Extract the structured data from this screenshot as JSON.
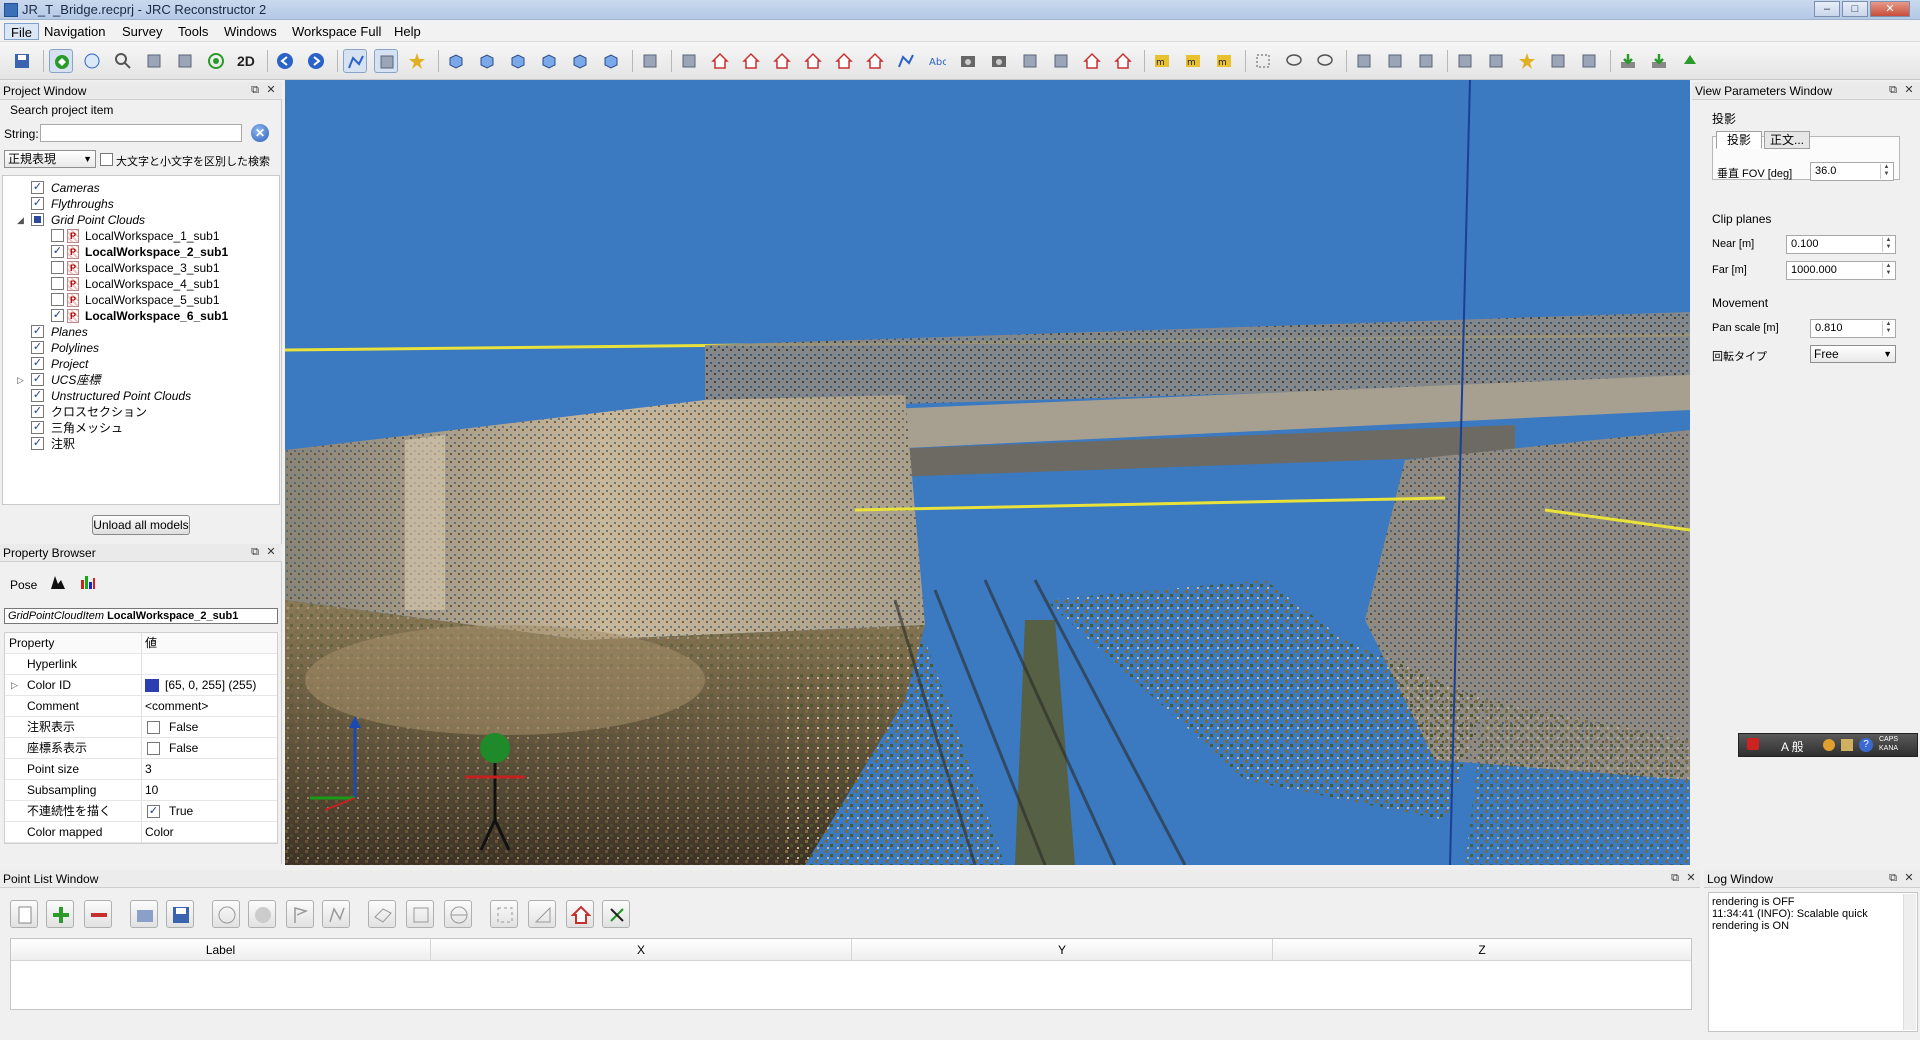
{
  "window": {
    "title": "JR_T_Bridge.recprj - JRC Reconstructor 2",
    "min_label": "–",
    "max_label": "□",
    "close_label": "✕"
  },
  "menu": [
    "File",
    "Navigation",
    "Survey",
    "Tools",
    "Windows",
    "Workspace Full",
    "Help"
  ],
  "toolbar": {
    "mode_2d_label": "2D",
    "icons": [
      "save-icon",
      "select-icon",
      "sphere-icon",
      "zoom-icon",
      "pick-point-icon",
      "move-icon",
      "target-icon",
      "back-arrow-icon",
      "forward-arrow-icon",
      "measure-icon",
      "pan-icon",
      "star-icon",
      "cube-front-icon",
      "cube-back-icon",
      "cube-left-icon",
      "cube-right-icon",
      "cube-top-icon",
      "cube-bottom-icon",
      "pipette-icon",
      "palette-icon",
      "house-icon",
      "house-alt-icon",
      "building-icon",
      "camera-house-icon",
      "grid-house-icon",
      "home-icon",
      "polyline-icon",
      "text-icon",
      "camera-icon",
      "photo-icon",
      "eye-icon",
      "stripes-icon",
      "house-arrow-icon",
      "house-blue-icon",
      "area-icon",
      "volume-icon",
      "m3-icon",
      "rect-select-icon",
      "lasso-icon",
      "lasso-alt-icon",
      "mesh-icon",
      "scissors-icon",
      "filter-icon",
      "layers-icon",
      "layers-alt-icon",
      "sparkle-icon",
      "hand-icon",
      "grid-icon",
      "export-icon",
      "download-icon",
      "recycle-icon"
    ]
  },
  "project_window": {
    "title": "Project Window",
    "search_label": "Search project item",
    "string_label": "String:",
    "string_value": "",
    "mode_value": "正規表現",
    "case_label": "大文字と小文字を区別した検索",
    "tree": [
      {
        "label": "Cameras",
        "checked": true,
        "level": 0,
        "kind": "cat"
      },
      {
        "label": "Flythroughs",
        "checked": true,
        "level": 0,
        "kind": "cat"
      },
      {
        "label": "Grid Point Clouds",
        "checked": "partial",
        "level": 0,
        "kind": "cat",
        "expander": "◢"
      },
      {
        "label": "LocalWorkspace_1_sub1",
        "checked": false,
        "level": 1,
        "kind": "item"
      },
      {
        "label": "LocalWorkspace_2_sub1",
        "checked": true,
        "level": 1,
        "kind": "bold"
      },
      {
        "label": "LocalWorkspace_3_sub1",
        "checked": false,
        "level": 1,
        "kind": "item"
      },
      {
        "label": "LocalWorkspace_4_sub1",
        "checked": false,
        "level": 1,
        "kind": "item"
      },
      {
        "label": "LocalWorkspace_5_sub1",
        "checked": false,
        "level": 1,
        "kind": "item"
      },
      {
        "label": "LocalWorkspace_6_sub1",
        "checked": true,
        "level": 1,
        "kind": "bold"
      },
      {
        "label": "Planes",
        "checked": true,
        "level": 0,
        "kind": "cat"
      },
      {
        "label": "Polylines",
        "checked": true,
        "level": 0,
        "kind": "cat"
      },
      {
        "label": "Project",
        "checked": true,
        "level": 0,
        "kind": "cat"
      },
      {
        "label": "UCS座標",
        "checked": true,
        "level": 0,
        "kind": "cat",
        "expander": "▷"
      },
      {
        "label": "Unstructured Point Clouds",
        "checked": true,
        "level": 0,
        "kind": "cat"
      },
      {
        "label": "クロスセクション",
        "checked": true,
        "level": 0,
        "kind": "plain"
      },
      {
        "label": "三角メッシュ",
        "checked": true,
        "level": 0,
        "kind": "plain"
      },
      {
        "label": "注釈",
        "checked": true,
        "level": 0,
        "kind": "plain"
      }
    ],
    "unload_label": "Unload all models"
  },
  "property_browser": {
    "title": "Property Browser",
    "pose_label": "Pose",
    "item_type": "GridPointCloudItem",
    "item_name": "LocalWorkspace_2_sub1",
    "header_property": "Property",
    "header_value": "値",
    "rows": [
      {
        "name": "Hyperlink",
        "value": ""
      },
      {
        "name": "Color ID",
        "value": "[65, 0, 255] (255)",
        "swatch": "#2b3fb0",
        "expander": "▷"
      },
      {
        "name": "Comment",
        "value": "<comment>"
      },
      {
        "name": "注釈表示",
        "value": "False",
        "check": false
      },
      {
        "name": "座標系表示",
        "value": "False",
        "check": false
      },
      {
        "name": "Point size",
        "value": "3"
      },
      {
        "name": "Subsampling",
        "value": "10"
      },
      {
        "name": "不連続性を描く",
        "value": "True",
        "check": true
      },
      {
        "name": "Color mapped",
        "value": "Color"
      }
    ]
  },
  "view_params": {
    "title": "View Parameters Window",
    "projection_group": "投影",
    "tabs": [
      "投影",
      "正文..."
    ],
    "fov_label": "垂直 FOV [deg]",
    "fov_value": "36.0",
    "clip_group": "Clip planes",
    "near_label": "Near [m]",
    "near_value": "0.100",
    "far_label": "Far [m]",
    "far_value": "1000.000",
    "movement_group": "Movement",
    "pan_label": "Pan scale [m]",
    "pan_value": "0.810",
    "rotate_label": "回転タイプ",
    "rotate_value": "Free"
  },
  "point_list": {
    "title": "Point List Window",
    "columns": [
      "Label",
      "X",
      "Y",
      "Z"
    ]
  },
  "log_window": {
    "title": "Log Window",
    "lines": [
      "rendering is OFF",
      "11:34:41 (INFO): Scalable quick",
      "rendering is ON"
    ]
  },
  "ime": {
    "text": "A 般",
    "caps": "CAPS",
    "kana": "KANA"
  },
  "colors": {
    "sky": "#3b79c0",
    "ground": "#5a4a34",
    "yellow_line": "#e8e23a",
    "selection": "#2b3fb0"
  }
}
